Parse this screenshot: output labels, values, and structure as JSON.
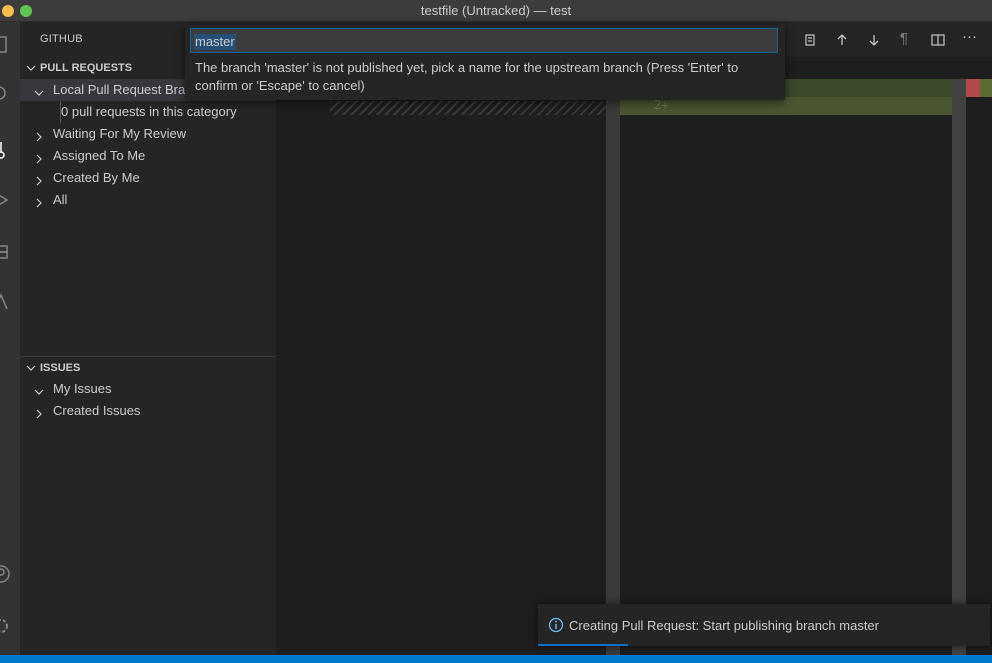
{
  "window": {
    "title": "testfile (Untracked) — test"
  },
  "sidebar": {
    "header": "GITHUB",
    "pull_requests": {
      "title": "PULL REQUESTS",
      "items": [
        {
          "label": "Local Pull Request Branches",
          "expanded": true
        },
        {
          "label": "0 pull requests in this category"
        },
        {
          "label": "Waiting For My Review",
          "expanded": false
        },
        {
          "label": "Assigned To Me",
          "expanded": false
        },
        {
          "label": "Created By Me",
          "expanded": false
        },
        {
          "label": "All",
          "expanded": false
        }
      ]
    },
    "issues": {
      "title": "ISSUES",
      "items": [
        {
          "label": "My Issues",
          "expanded": true
        },
        {
          "label": "Created Issues",
          "expanded": false
        }
      ]
    }
  },
  "editor": {
    "line_number": "2+"
  },
  "quick_input": {
    "value": "master",
    "message": "The branch 'master' is not published yet, pick a name for the upstream branch (Press 'Enter' to confirm or 'Escape' to cancel)"
  },
  "notification": {
    "icon": "info-icon",
    "text": "Creating Pull Request: Start publishing branch master"
  },
  "toolbar": {
    "icons": [
      "open-changes-icon",
      "arrow-up-icon",
      "arrow-down-icon",
      "pilcrow-icon",
      "split-editor-icon",
      "more-icon"
    ],
    "pilcrow": "¶",
    "more": "···"
  },
  "colors": {
    "accent": "#007acc",
    "sidebar": "#252526",
    "editor": "#1e1e1e",
    "focus_border": "#0e639c"
  }
}
